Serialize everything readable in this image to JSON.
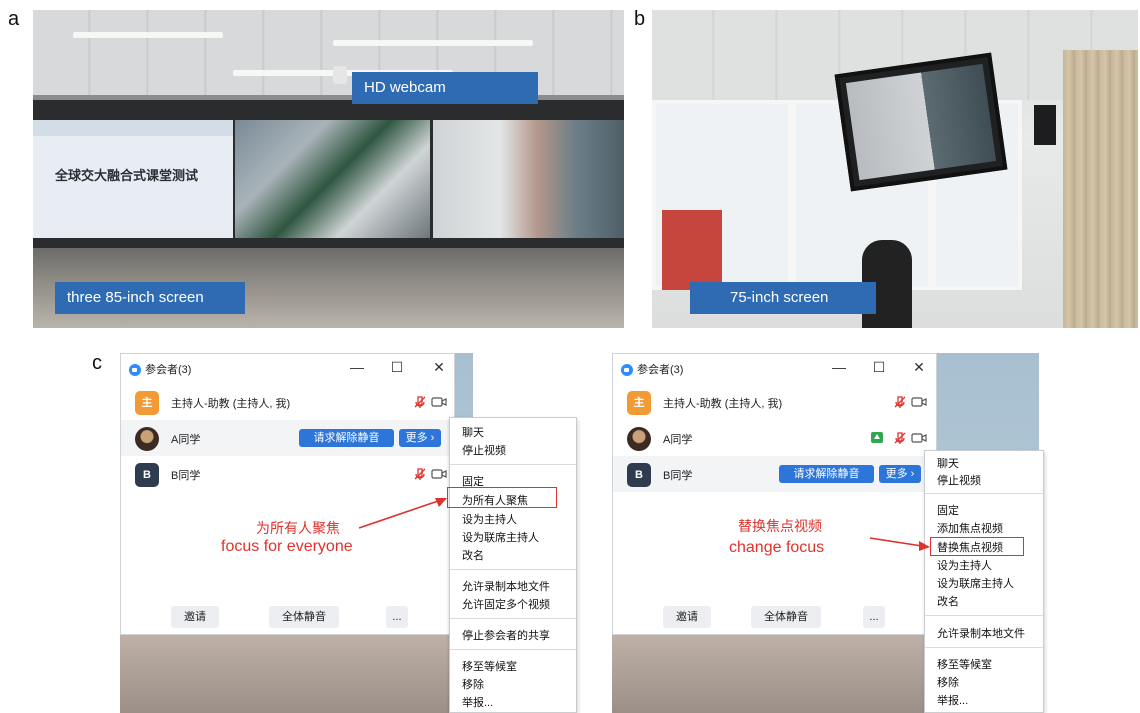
{
  "panels": {
    "a": {
      "letter": "a",
      "labels": {
        "webcam": "HD webcam",
        "screens": "three 85-inch screen"
      },
      "slide_title": "全球交大融合式课堂测试"
    },
    "b": {
      "letter": "b",
      "labels": {
        "screen": "75-inch screen"
      }
    },
    "c": {
      "letter": "c"
    }
  },
  "zoom_left": {
    "title": "参会者(3)",
    "window_controls": {
      "minimize": "—",
      "maximize": "☐",
      "close": "✕"
    },
    "participants": [
      {
        "avatar_text": "主",
        "name": "主持人-助教 (主持人, 我)"
      },
      {
        "avatar_text": "",
        "name": "A同学",
        "unmute_button": "请求解除静音",
        "more_button": "更多 ›"
      },
      {
        "avatar_text": "B",
        "name": "B同学"
      }
    ],
    "bottom_buttons": {
      "invite": "邀请",
      "mute_all": "全体静音",
      "more": "..."
    },
    "menu_items": [
      "聊天",
      "停止视频",
      "固定",
      "为所有人聚焦",
      "设为主持人",
      "设为联席主持人",
      "改名",
      "允许录制本地文件",
      "允许固定多个视频",
      "停止参会者的共享",
      "移至等候室",
      "移除",
      "举报..."
    ],
    "highlighted_item": "为所有人聚焦",
    "annotation_cn": "为所有人聚焦",
    "annotation_en": "focus for everyone"
  },
  "zoom_right": {
    "title": "参会者(3)",
    "window_controls": {
      "minimize": "—",
      "maximize": "☐",
      "close": "✕"
    },
    "participants": [
      {
        "avatar_text": "主",
        "name": "主持人-助教 (主持人, 我)"
      },
      {
        "avatar_text": "",
        "name": "A同学"
      },
      {
        "avatar_text": "B",
        "name": "B同学",
        "unmute_button": "请求解除静音",
        "more_button": "更多 ›"
      }
    ],
    "bottom_buttons": {
      "invite": "邀请",
      "mute_all": "全体静音",
      "more": "..."
    },
    "menu_items": [
      "聊天",
      "停止视频",
      "固定",
      "添加焦点视频",
      "替换焦点视频",
      "设为主持人",
      "设为联席主持人",
      "改名",
      "允许录制本地文件",
      "移至等候室",
      "移除",
      "举报..."
    ],
    "highlighted_item": "替换焦点视频",
    "annotation_cn": "替换焦点视频",
    "annotation_en": "change focus"
  },
  "colors": {
    "label_blue": "#2f6bb3",
    "zoom_blue": "#2d75d8",
    "annotation_red": "#e0322c",
    "host_orange": "#f29a34"
  }
}
